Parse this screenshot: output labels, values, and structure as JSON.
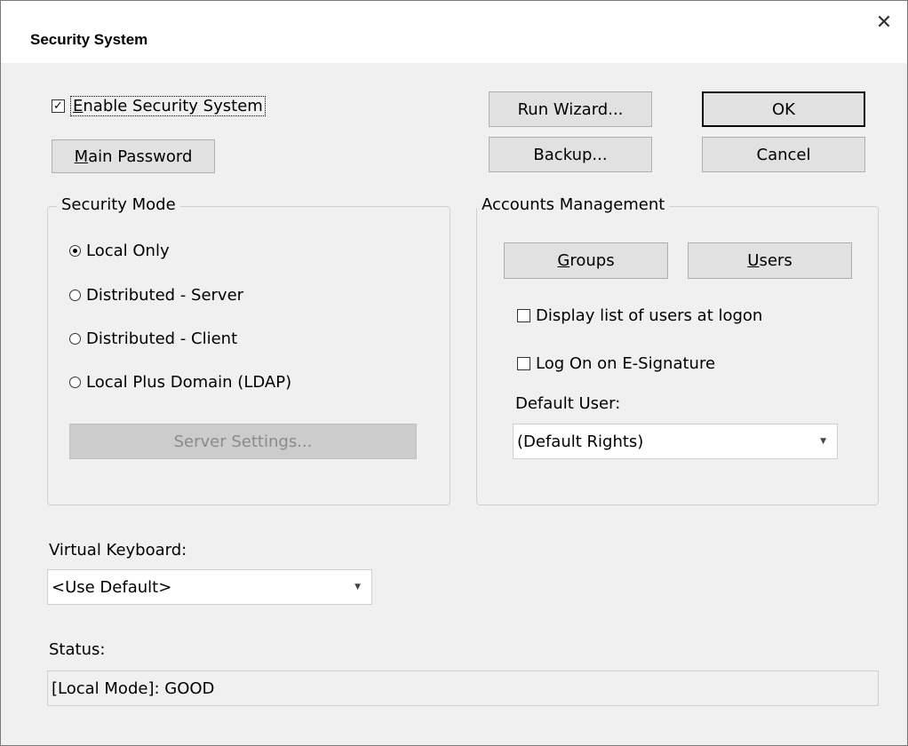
{
  "window": {
    "title": "Security System",
    "close_symbol": "✕"
  },
  "top": {
    "enable_security": {
      "label": "Enable Security System",
      "checked": true
    },
    "main_password_label": "Main Password",
    "run_wizard_label": "Run Wizard...",
    "ok_label": "OK",
    "backup_label": "Backup...",
    "cancel_label": "Cancel"
  },
  "security_mode": {
    "legend": "Security Mode",
    "options": [
      {
        "label": "Local Only",
        "selected": true
      },
      {
        "label": "Distributed - Server",
        "selected": false
      },
      {
        "label": "Distributed - Client",
        "selected": false
      },
      {
        "label": "Local Plus Domain (LDAP)",
        "selected": false
      }
    ],
    "server_settings_label": "Server Settings..."
  },
  "accounts": {
    "legend": "Accounts Management",
    "groups_label": "Groups",
    "users_label": "Users",
    "display_users_label": "Display list of users at logon",
    "logon_esig_label": "Log On on E-Signature",
    "default_user_label": "Default User:",
    "default_user_value": "(Default Rights)"
  },
  "virtual_keyboard": {
    "label": "Virtual Keyboard:",
    "value": "<Use Default>"
  },
  "status": {
    "label": "Status:",
    "value": "[Local Mode]: GOOD"
  }
}
